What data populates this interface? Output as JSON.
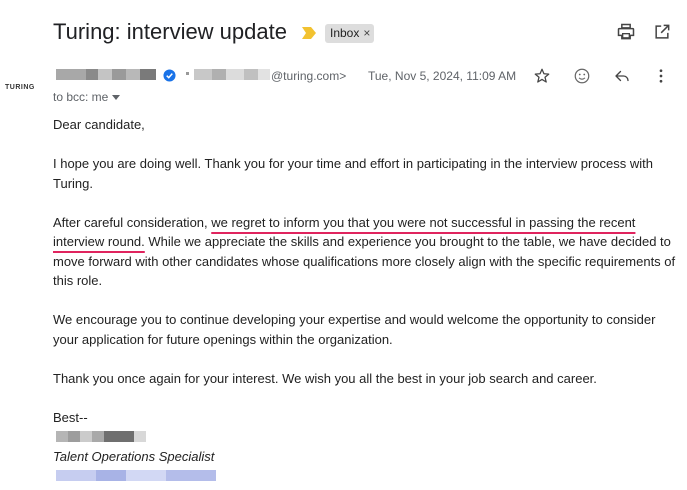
{
  "email": {
    "subject": "Turing: interview update",
    "label": "Inbox",
    "label_remove": "×",
    "logo_text": "TURING",
    "sender_email": "@turing.com>",
    "date": "Tue, Nov 5, 2024, 11:09 AM",
    "to_line": "to bcc: me",
    "body": {
      "greeting": "Dear candidate,",
      "p1": "I hope you are doing well. Thank you for your time and effort in participating in the interview process with Turing.",
      "p2_pre": "After careful consideration, ",
      "p2_highlight": "we regret to inform you that you were not successful in passing the recent interview round.",
      "p2_post": " While we appreciate the skills and experience you brought to the table, we have decided to move forward with other candidates whose qualifications more closely align with the specific requirements of this role.",
      "p3": "We encourage you to continue developing your expertise and would welcome the opportunity to consider your application for future openings within the organization.",
      "p4": "Thank you once again for your interest. We wish you all the best in your job search and career.",
      "signoff": "Best--",
      "sig_title": "Talent Operations Specialist"
    }
  },
  "colors": {
    "highlight_underline": "#e0245e",
    "importance_marker": "#f2c230",
    "verified_badge": "#1a73e8"
  },
  "icons": [
    "importance-marker-icon",
    "print-icon",
    "open-in-new-window-icon",
    "verified-icon",
    "star-icon",
    "emoji-icon",
    "reply-icon",
    "more-vert-icon",
    "caret-down-icon"
  ]
}
